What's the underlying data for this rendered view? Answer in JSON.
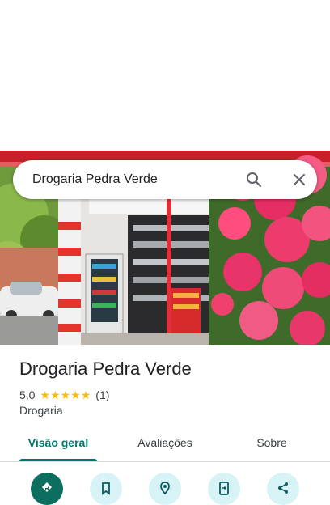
{
  "search": {
    "query": "Drogaria Pedra Verde",
    "search_icon": "search-icon",
    "clear_icon": "close-icon"
  },
  "place": {
    "name": "Drogaria Pedra Verde",
    "rating": "5,0",
    "stars": 5,
    "review_count": "(1)",
    "category": "Drogaria"
  },
  "tabs": [
    {
      "label": "Visão geral",
      "active": true
    },
    {
      "label": "Avaliações",
      "active": false
    },
    {
      "label": "Sobre",
      "active": false
    }
  ],
  "actions": [
    {
      "icon": "directions-icon"
    },
    {
      "icon": "bookmark-icon"
    },
    {
      "icon": "nearby-icon"
    },
    {
      "icon": "send-to-phone-icon"
    },
    {
      "icon": "share-icon"
    }
  ],
  "colors": {
    "accent": "#00796b",
    "star": "#fbbc04",
    "action_bg": "#d7f3f6",
    "primary_action": "#0b6e5f"
  }
}
